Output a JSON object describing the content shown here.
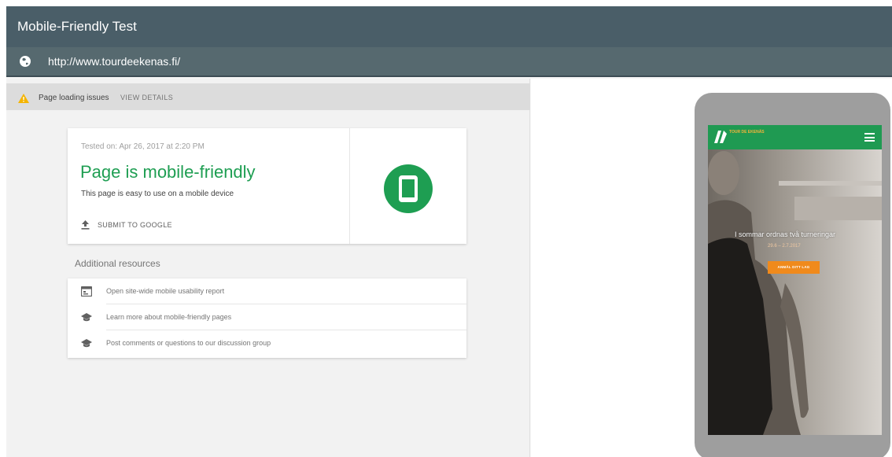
{
  "app": {
    "title": "Mobile-Friendly Test"
  },
  "url_bar": {
    "url": "http://www.tourdeekenas.fi/",
    "icon": "globe-icon"
  },
  "issues": {
    "label": "Page loading issues",
    "action": "VIEW DETAILS",
    "icon": "warning-icon",
    "color": "#f4b400"
  },
  "result": {
    "tested_on": "Tested on: Apr 26, 2017 at 2:20 PM",
    "title": "Page is mobile-friendly",
    "subtitle": "This page is easy to use on a mobile device",
    "submit_label": "SUBMIT TO GOOGLE",
    "status_color": "#1e9e52",
    "badge_icon": "smartphone-icon"
  },
  "resources": {
    "title": "Additional resources",
    "items": [
      {
        "label": "Open site-wide mobile usability report",
        "icon": "report-icon"
      },
      {
        "label": "Learn more about mobile-friendly pages",
        "icon": "school-icon"
      },
      {
        "label": "Post comments or questions to our discussion group",
        "icon": "school-icon"
      }
    ]
  },
  "preview": {
    "logo_text": "TOUR DE EKENÄS",
    "hero_text": "I sommar ordnas två turneringar",
    "hero_date": "29.6 – 2.7.2017",
    "cta_label": "ANMÄL DITT LAG",
    "header_color": "#1f9a52",
    "cta_color": "#f08a1c"
  }
}
